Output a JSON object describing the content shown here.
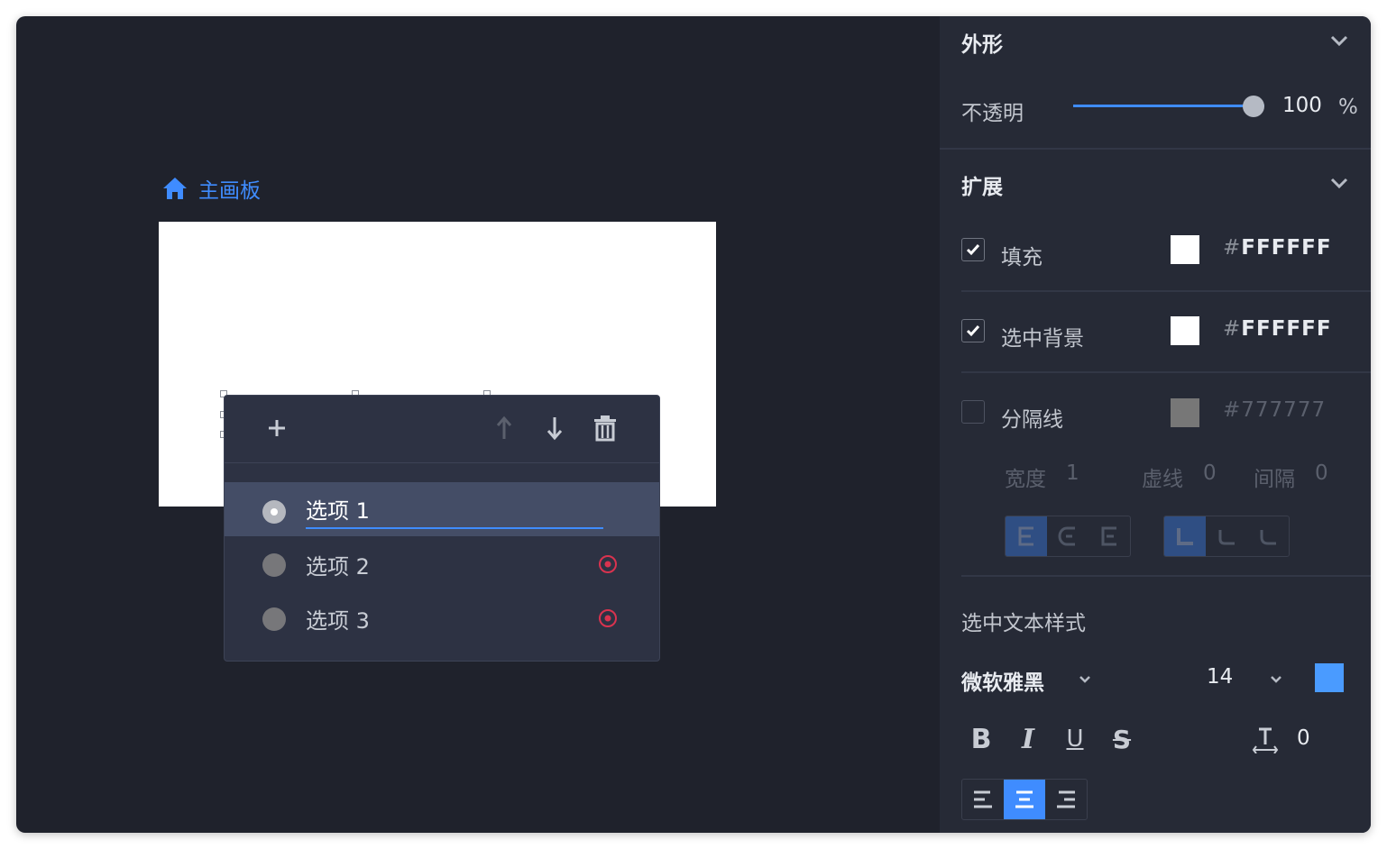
{
  "canvas": {
    "board_label": "主画板"
  },
  "popover": {
    "toolbar": {
      "add_icon": "plus-icon",
      "up_icon": "arrow-up-icon",
      "down_icon": "arrow-down-icon",
      "delete_icon": "trash-icon"
    },
    "options": [
      {
        "label": "选项 1",
        "selected": true
      },
      {
        "label": "选项 2",
        "selected": false
      },
      {
        "label": "选项 3",
        "selected": false
      }
    ]
  },
  "panel": {
    "appearance": {
      "title": "外形",
      "opacity_label": "不透明",
      "opacity_value": "100",
      "opacity_unit": "%",
      "opacity_fraction": 1.0
    },
    "extend": {
      "title": "扩展",
      "fill": {
        "label": "填充",
        "checked": true,
        "hash": "#",
        "hex": "FFFFFF",
        "color": "#FFFFFF"
      },
      "selected_bg": {
        "label": "选中背景",
        "checked": true,
        "hash": "#",
        "hex": "FFFFFF",
        "color": "#FFFFFF"
      },
      "divider": {
        "label": "分隔线",
        "checked": false,
        "hash": "#",
        "hex": "777777",
        "color": "#777777",
        "width_label": "宽度",
        "width_value": "1",
        "dash_label": "虚线",
        "dash_value": "0",
        "gap_label": "间隔",
        "gap_value": "0"
      }
    },
    "text_style": {
      "title": "选中文本样式",
      "font_family": "微软雅黑",
      "font_size": "14",
      "color": "#4A9BFF",
      "bold_label": "B",
      "italic_label": "I",
      "underline_label": "U",
      "strike_label": "S",
      "spacing_value": "0",
      "align_selected": "center"
    }
  },
  "colors": {
    "accent": "#3F8CFF",
    "danger": "#D9334F",
    "background": "#1F222C"
  }
}
